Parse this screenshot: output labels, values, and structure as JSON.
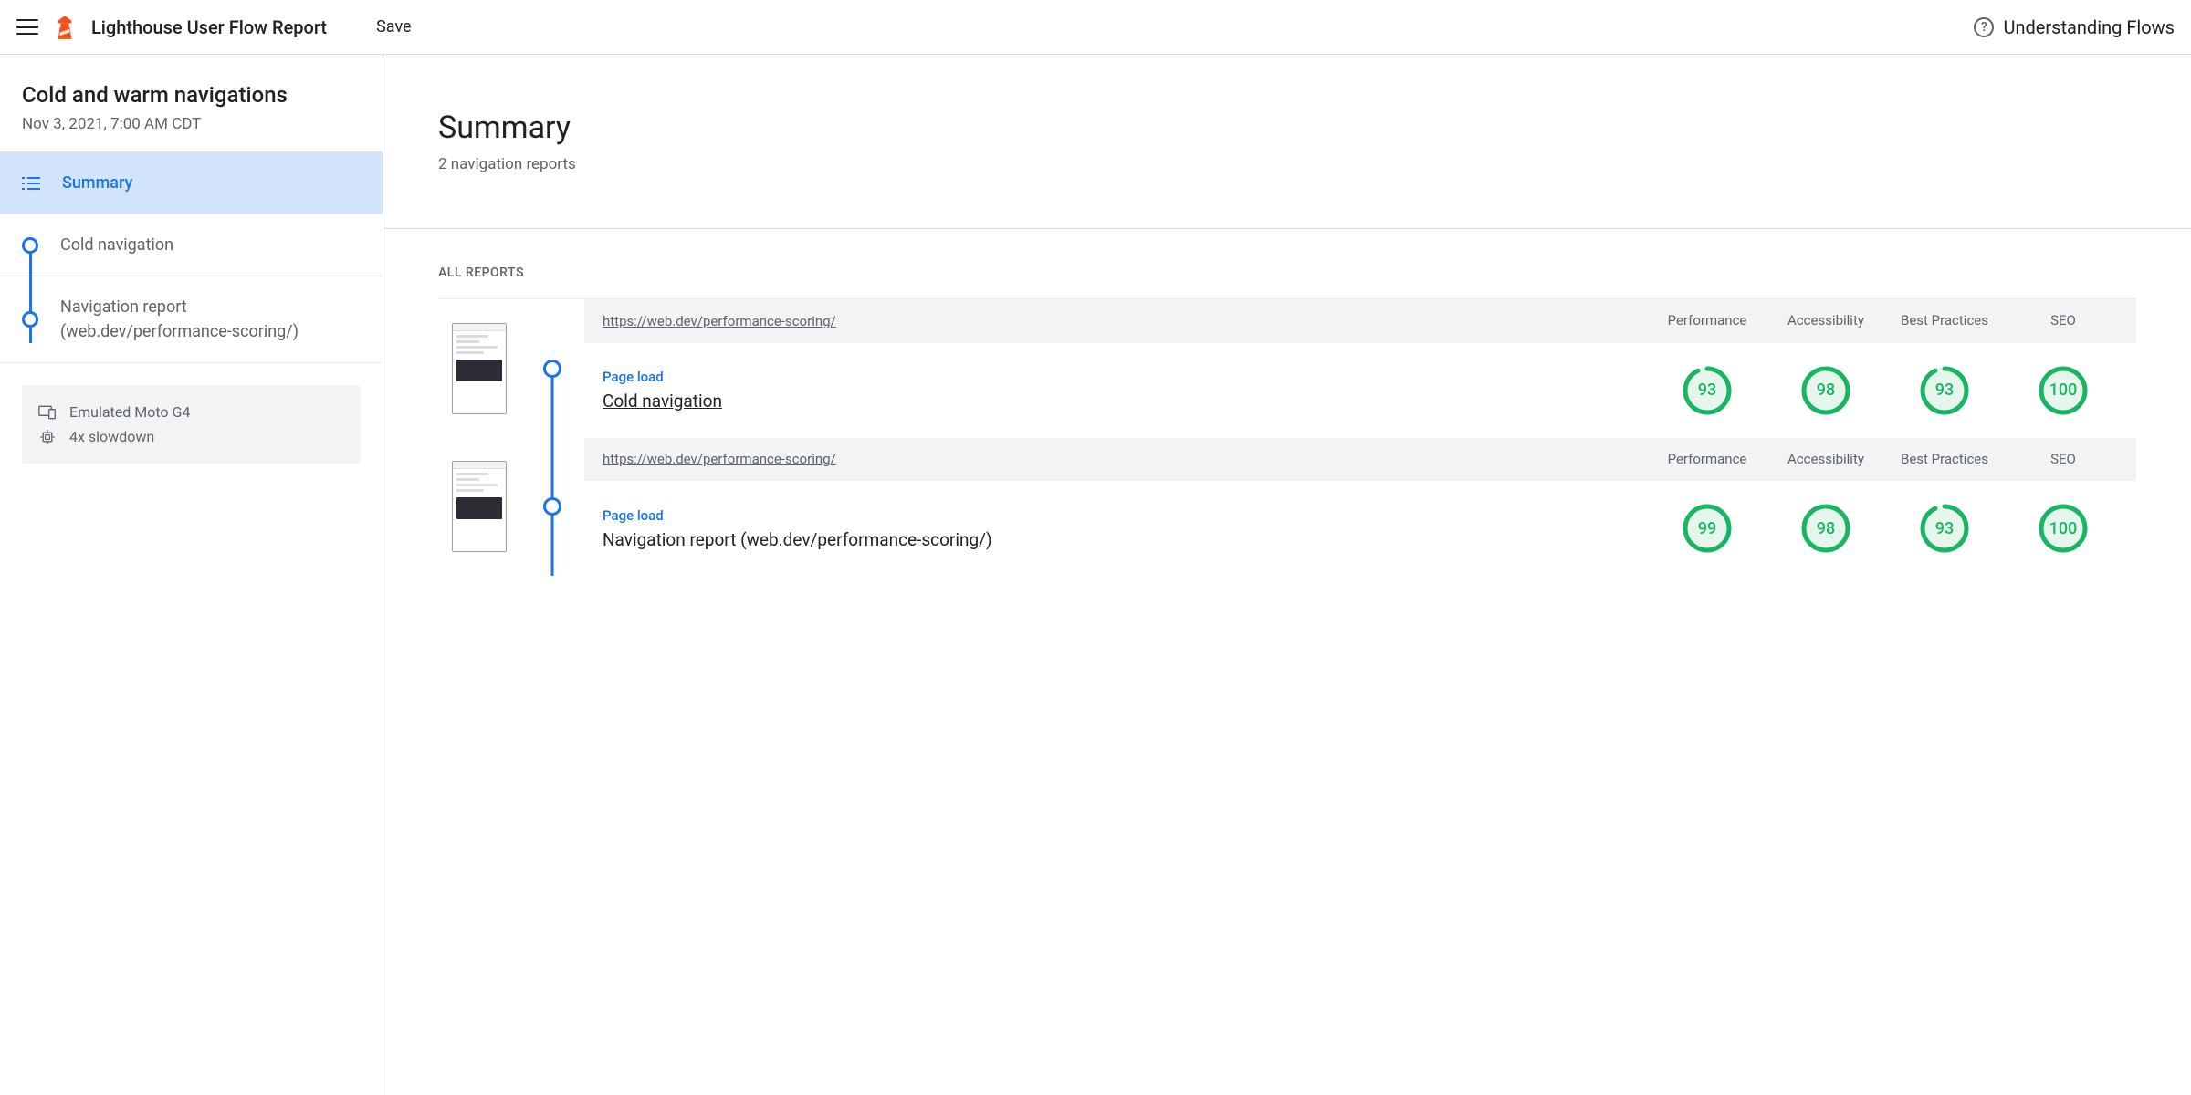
{
  "topbar": {
    "title": "Lighthouse User Flow Report",
    "save": "Save",
    "help": "Understanding Flows"
  },
  "sidebar": {
    "title": "Cold and warm navigations",
    "date": "Nov 3, 2021, 7:00 AM CDT",
    "summary": "Summary",
    "steps": [
      {
        "label": "Cold navigation"
      },
      {
        "label": "Navigation report (web.dev/performance-scoring/)"
      }
    ],
    "device": {
      "emulated": "Emulated Moto G4",
      "throttle": "4x slowdown"
    }
  },
  "main": {
    "title": "Summary",
    "subtitle": "2 navigation reports",
    "section": "ALL REPORTS",
    "columns": {
      "perf": "Performance",
      "a11y": "Accessibility",
      "bp": "Best Practices",
      "seo": "SEO"
    },
    "stepType": "Page load",
    "reports": [
      {
        "url": "https://web.dev/performance-scoring/",
        "name": "Cold navigation",
        "scores": {
          "perf": 93,
          "a11y": 98,
          "bp": 93,
          "seo": 100
        }
      },
      {
        "url": "https://web.dev/performance-scoring/",
        "name": "Navigation report (web.dev/performance-scoring/)",
        "scores": {
          "perf": 99,
          "a11y": 98,
          "bp": 93,
          "seo": 100
        }
      }
    ]
  },
  "colors": {
    "pass": "#18b663",
    "passFill": "#e6f6ec",
    "link": "#1a73e8"
  }
}
